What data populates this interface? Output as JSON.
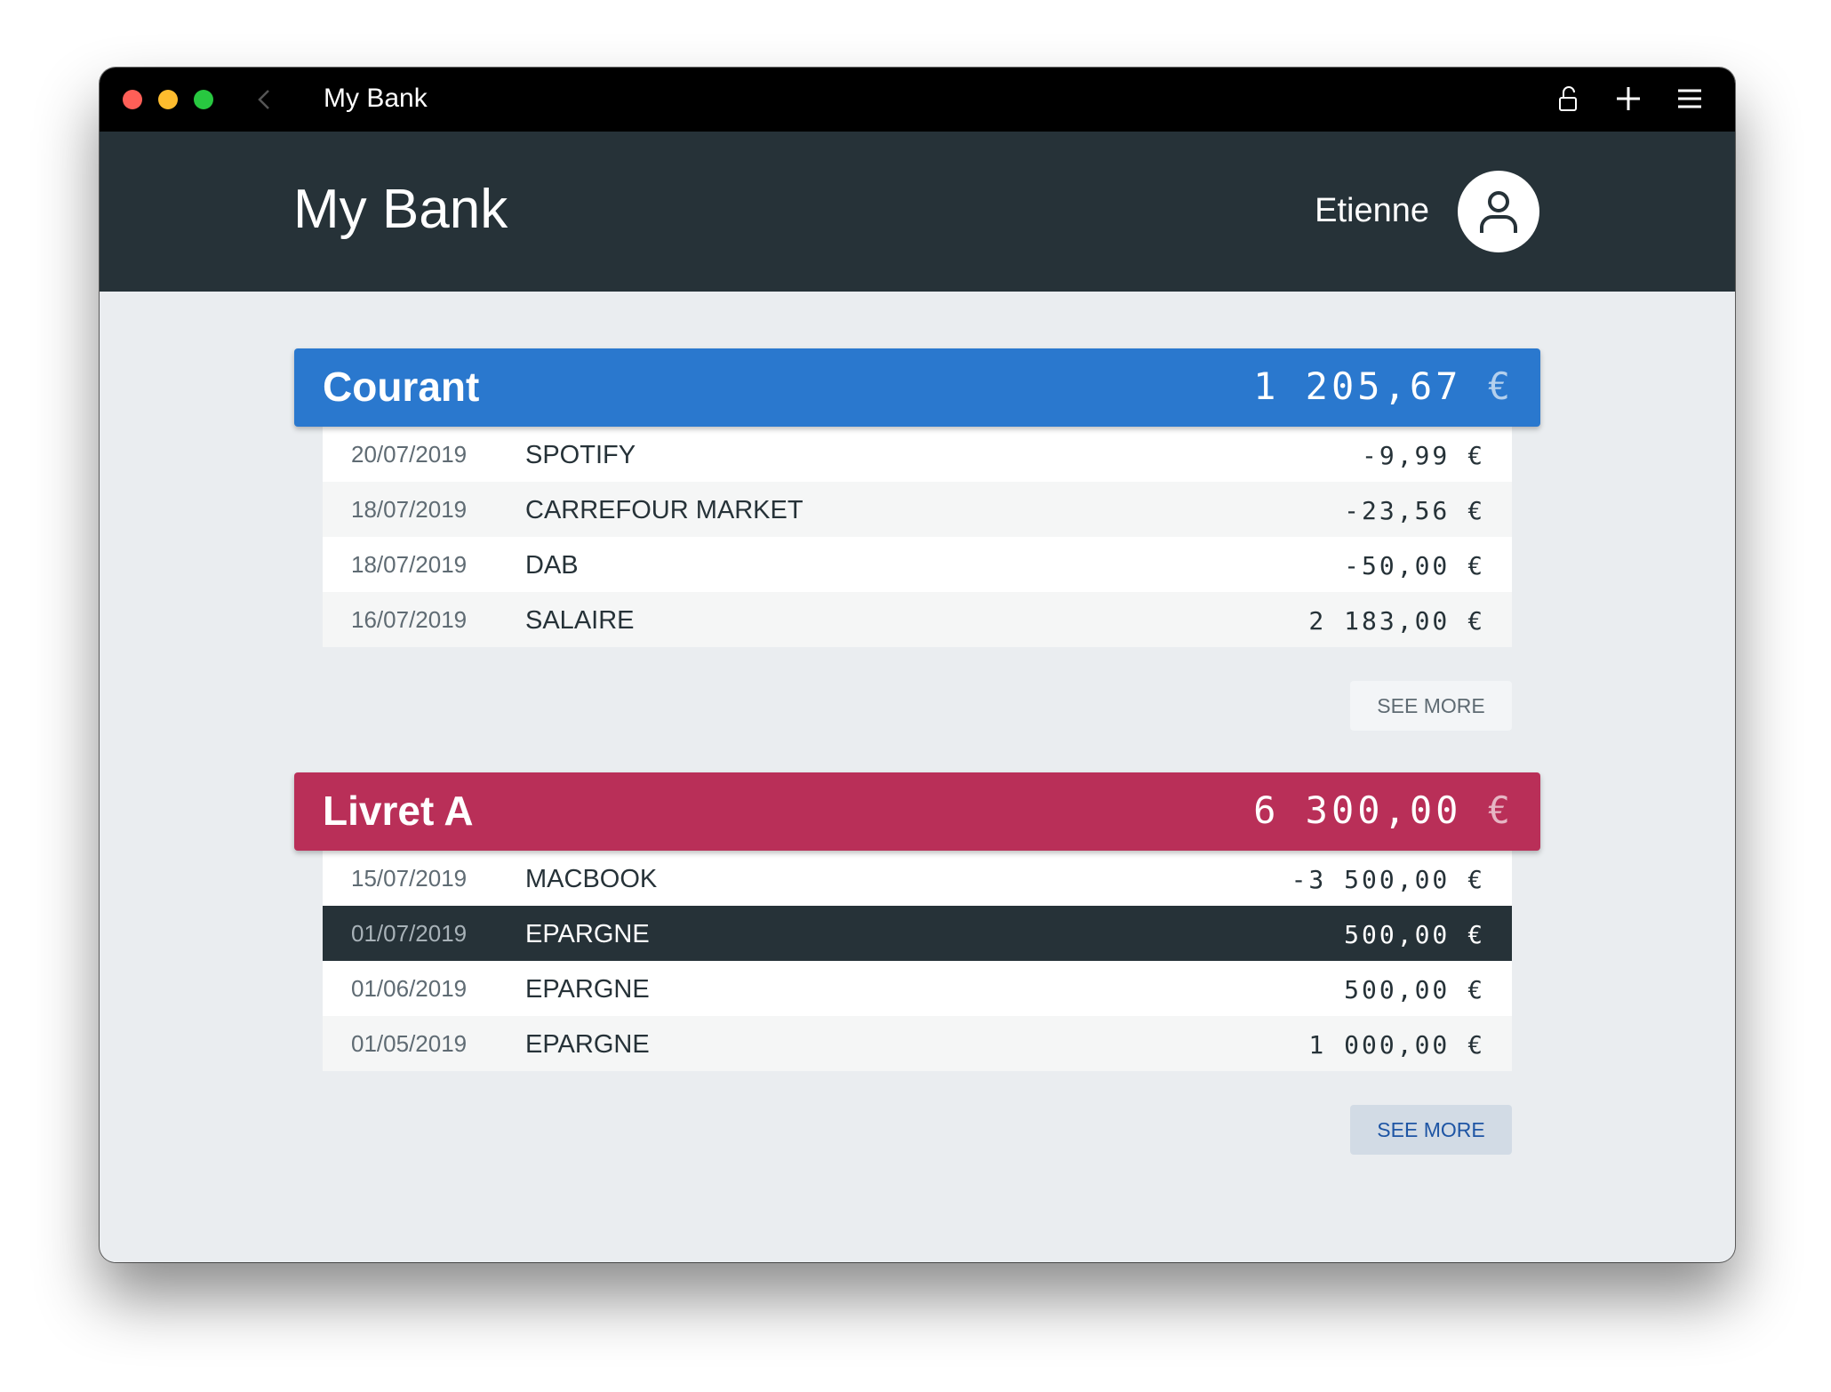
{
  "window": {
    "title": "My Bank"
  },
  "header": {
    "app_title": "My Bank",
    "user_name": "Etienne"
  },
  "accounts": [
    {
      "name": "Courant",
      "balance": "1 205,67",
      "currency": "€",
      "color": "#2a78ce",
      "transactions": [
        {
          "date": "20/07/2019",
          "label": "SPOTIFY",
          "amount": "-9,99 €"
        },
        {
          "date": "18/07/2019",
          "label": "CARREFOUR MARKET",
          "amount": "-23,56 €"
        },
        {
          "date": "18/07/2019",
          "label": "DAB",
          "amount": "-50,00 €"
        },
        {
          "date": "16/07/2019",
          "label": "SALAIRE",
          "amount": "2 183,00 €"
        }
      ],
      "see_more_label": "SEE MORE"
    },
    {
      "name": "Livret A",
      "balance": "6 300,00",
      "currency": "€",
      "color": "#b92f58",
      "transactions": [
        {
          "date": "15/07/2019",
          "label": "MACBOOK",
          "amount": "-3 500,00 €"
        },
        {
          "date": "01/07/2019",
          "label": "EPARGNE",
          "amount": "500,00 €"
        },
        {
          "date": "01/06/2019",
          "label": "EPARGNE",
          "amount": "500,00 €"
        },
        {
          "date": "01/05/2019",
          "label": "EPARGNE",
          "amount": "1 000,00 €"
        }
      ],
      "see_more_label": "SEE MORE"
    }
  ],
  "selected_transaction": "accounts.1.transactions.1",
  "icons": {
    "back": "chevron-left-icon",
    "lock": "unlock-icon",
    "add": "plus-icon",
    "menu": "hamburger-menu-icon",
    "avatar": "user-icon"
  }
}
